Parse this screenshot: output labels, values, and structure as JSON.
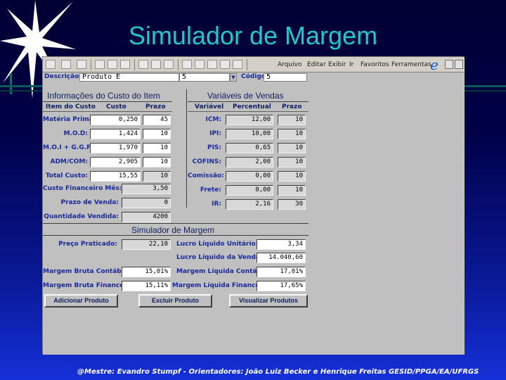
{
  "slide": {
    "title": "Simulador de Margem",
    "footer": "@Mestre: Evandro Stumpf - Orientadores: João Luiz Becker e Henrique Freitas GESID/PPGA/EA/UFRGS"
  },
  "toolbar": {
    "menus": [
      "Arquivo",
      "Editar",
      "Exibir",
      "Ir",
      "Favoritos",
      "Ferramentas"
    ]
  },
  "descricao": {
    "label": "Descrição:",
    "value": "Produto E",
    "code_combo": "5",
    "codigo_label": "Código:",
    "codigo_value": "5"
  },
  "custo": {
    "title": "Informações do Custo do Item",
    "headers": {
      "item": "Item do Custo",
      "custo": "Custo",
      "prazo": "Prazo"
    },
    "rows": [
      {
        "label": "Matéria Prima:",
        "custo": "0,250",
        "prazo": "45"
      },
      {
        "label": "M.O.D:",
        "custo": "1,424",
        "prazo": "10"
      },
      {
        "label": "M.O.I + G.G.F:",
        "custo": "1,970",
        "prazo": "10"
      },
      {
        "label": "ADM/COM:",
        "custo": "2,905",
        "prazo": "10"
      },
      {
        "label": "Total Custo:",
        "custo": "15,55",
        "prazo": "10"
      }
    ],
    "custo_financeiro": {
      "label": "Custo Financeiro Mês:",
      "value": "3,50"
    },
    "prazo_venda": {
      "label": "Prazo de Venda:",
      "value": "0"
    },
    "quantidade": {
      "label": "Quantidade Vendida:",
      "value": "4200"
    }
  },
  "vendas": {
    "title": "Variáveis de Vendas",
    "headers": {
      "variavel": "Variável",
      "percentual": "Percentual",
      "prazo": "Prazo"
    },
    "rows": [
      {
        "label": "ICM:",
        "percentual": "12,00",
        "prazo": "10"
      },
      {
        "label": "IPI:",
        "percentual": "10,00",
        "prazo": "10"
      },
      {
        "label": "PIS:",
        "percentual": "0,65",
        "prazo": "10"
      },
      {
        "label": "COFINS:",
        "percentual": "2,00",
        "prazo": "10"
      },
      {
        "label": "Comissão:",
        "percentual": "0,00",
        "prazo": "10"
      },
      {
        "label": "Frete:",
        "percentual": "0,00",
        "prazo": "10"
      },
      {
        "label": "IR:",
        "percentual": "2,16",
        "prazo": "30"
      }
    ]
  },
  "simulador": {
    "title": "Simulador de Margem",
    "preco": {
      "label": "Preço Praticado:",
      "value": "22,10"
    },
    "lucro_unitario": {
      "label": "Lucro Líquido Unitário:",
      "value": "3,34"
    },
    "lucro_venda": {
      "label": "Lucro Líquido da Venda:",
      "value": "14.040,60"
    },
    "mbc": {
      "label": "Margem Bruta Contábil:",
      "value": "15,01%"
    },
    "mlc": {
      "label": "Margem Líquida Contábil:",
      "value": "17,01%"
    },
    "mbf": {
      "label": "Margem Bruta Financeira:",
      "value": "15,11%"
    },
    "mlf": {
      "label": "Margem Líquida Financeira:",
      "value": "17,65%"
    }
  },
  "buttons": {
    "adicionar": "Adicionar Produto",
    "excluir": "Excluir Produto",
    "visualizar": "Visualizar Produtos"
  }
}
